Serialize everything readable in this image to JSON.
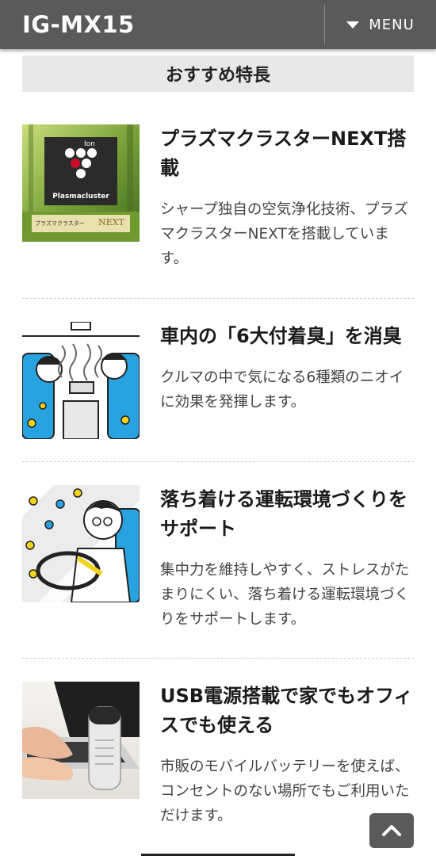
{
  "header": {
    "title": "IG-MX15",
    "menu_label": "MENU"
  },
  "section": {
    "title": "おすすめ特長"
  },
  "features": [
    {
      "heading": "プラズマクラスターNEXT搭載",
      "description": "シャープ独自の空気浄化技術、プラズマクラスターNEXTを搭載しています。",
      "image_text": {
        "brand": "Plasmacluster",
        "ion": "Ion",
        "badge_jp": "プラズマクラスター",
        "badge_en": "NEXT"
      }
    },
    {
      "heading": "車内の「6大付着臭」を消臭",
      "description": "クルマの中で気になる6種類のニオイに効果を発揮します。"
    },
    {
      "heading": "落ち着ける運転環境づくりをサポート",
      "description": "集中力を維持しやすく、ストレスがたまりにくい、落ち着ける運転環境づくりをサポートします。"
    },
    {
      "heading": "USB電源搭載で家でもオフィスでも使える",
      "description": "市販のモバイルバッテリーを使えば、コンセントのない場所でもご利用いただけます。"
    }
  ],
  "icons": {
    "menu": "caret-down-icon",
    "back_to_top": "chevron-up-icon"
  },
  "colors": {
    "header_bg": "#5a5a5a",
    "section_title_bg": "#e8e8e8",
    "plasmacluster_red": "#c8102e"
  }
}
